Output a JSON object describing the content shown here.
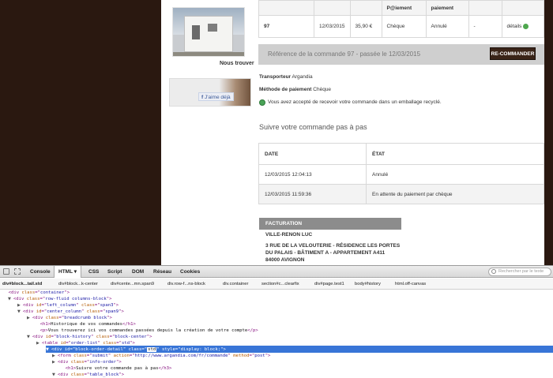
{
  "site": {
    "nous_trouver": "Nous trouver",
    "fb_like": "J'aime déjà",
    "orders": {
      "header": [
        "",
        "",
        "",
        "P@iement",
        "paiement",
        "",
        ""
      ],
      "row": [
        "97",
        "12/03/2015",
        "35,90 €",
        "Chèque",
        "Annulé",
        "-",
        "détails"
      ]
    },
    "reference_title": "Référence de la commande 97 - passée le 12/03/2015",
    "recommander": "RE-COMMANDER",
    "transporteur_label": "Transporteur",
    "transporteur_value": "Argandia",
    "paiement_label": "Méthode de paiement",
    "paiement_value": "Chèque",
    "recycle_text": "Vous avez accepté de recevoir votre commande dans un emballage recyclé.",
    "follow_title": "Suivre votre commande pas à pas",
    "history": {
      "headers": [
        "DATE",
        "ÉTAT"
      ],
      "rows": [
        [
          "12/03/2015 12:04:13",
          "Annulé"
        ],
        [
          "12/03/2015 11:59:36",
          "En attente du paiement par chèque"
        ]
      ]
    },
    "facturation_label": "FACTURATION",
    "address": [
      "VILLE-RENON LUC",
      "3 RUE DE LA VELOUTERIE - RÉSIDENCE LES PORTES",
      "DU PALAIS - BÂTIMENT A - APPARTEMENT A411",
      "84000 AVIGNON"
    ]
  },
  "devtools": {
    "tabs": [
      "Console",
      "HTML ▾",
      "CSS",
      "Script",
      "DOM",
      "Réseau",
      "Cookies"
    ],
    "search_placeholder": "Rechercher par le texte",
    "breadcrumbs": [
      "div#block...tail.std",
      "div#block...k-center",
      "div#cente...mn.span9",
      "div.row-f...ns-block",
      "div.container",
      "section#c...clearfix",
      "div#page.test1",
      "body#history",
      "html.off-canvas"
    ],
    "tree": [
      {
        "tw": "",
        "parts": [
          [
            "tag",
            "<div "
          ],
          [
            "an",
            "class"
          ],
          [
            "tag",
            "=\""
          ],
          [
            "av",
            "container"
          ],
          [
            "tag",
            "\">"
          ]
        ]
      },
      {
        "tw": "▼",
        "parts": [
          [
            "tag",
            "<div "
          ],
          [
            "an",
            "class"
          ],
          [
            "tag",
            "=\""
          ],
          [
            "av",
            "row-fluid columns-block"
          ],
          [
            "tag",
            "\">"
          ]
        ]
      },
      {
        "tw": "▶",
        "parts": [
          [
            "tag",
            "<div "
          ],
          [
            "an",
            "id"
          ],
          [
            "tag",
            "=\""
          ],
          [
            "av",
            "left_column"
          ],
          [
            "tag",
            "\" "
          ],
          [
            "an",
            "class"
          ],
          [
            "tag",
            "=\""
          ],
          [
            "av",
            "span3"
          ],
          [
            "tag",
            "\">"
          ]
        ]
      },
      {
        "tw": "▼",
        "parts": [
          [
            "tag",
            "<div "
          ],
          [
            "an",
            "id"
          ],
          [
            "tag",
            "=\""
          ],
          [
            "av",
            "center_column"
          ],
          [
            "tag",
            "\" "
          ],
          [
            "an",
            "class"
          ],
          [
            "tag",
            "=\""
          ],
          [
            "av",
            "span9"
          ],
          [
            "tag",
            "\">"
          ]
        ]
      },
      {
        "tw": "▶",
        "parts": [
          [
            "tag",
            "<div "
          ],
          [
            "an",
            "class"
          ],
          [
            "tag",
            "=\""
          ],
          [
            "av",
            "breadcrumb block"
          ],
          [
            "tag",
            "\">"
          ]
        ]
      },
      {
        "tw": "",
        "parts": [
          [
            "tag",
            "<h1>"
          ],
          [
            "tx",
            "Historique de vos commandes"
          ],
          [
            "tag",
            "</h1>"
          ]
        ]
      },
      {
        "tw": "",
        "parts": [
          [
            "tag",
            "<p>"
          ],
          [
            "tx",
            "Vous trouverez ici vos commandes passées depuis la création de votre compte"
          ],
          [
            "tag",
            "</p>"
          ]
        ]
      },
      {
        "tw": "▼",
        "parts": [
          [
            "tag",
            "<div "
          ],
          [
            "an",
            "id"
          ],
          [
            "tag",
            "=\""
          ],
          [
            "av",
            "block-history"
          ],
          [
            "tag",
            "\" "
          ],
          [
            "an",
            "class"
          ],
          [
            "tag",
            "=\""
          ],
          [
            "av",
            "block-center"
          ],
          [
            "tag",
            "\">"
          ]
        ]
      },
      {
        "tw": "▶",
        "parts": [
          [
            "tag",
            "<table "
          ],
          [
            "an",
            "id"
          ],
          [
            "tag",
            "=\""
          ],
          [
            "av",
            "order-list"
          ],
          [
            "tag",
            "\" "
          ],
          [
            "an",
            "class"
          ],
          [
            "tag",
            "=\""
          ],
          [
            "av",
            "std"
          ],
          [
            "tag",
            "\">"
          ]
        ]
      },
      {
        "tw": "▼",
        "parts": [
          [
            "tag",
            "<div "
          ],
          [
            "an",
            "id"
          ],
          [
            "tag",
            "=\""
          ],
          [
            "av",
            "block-order-detail"
          ],
          [
            "tag",
            "\" "
          ],
          [
            "an",
            "class"
          ],
          [
            "tag",
            "=\""
          ],
          [
            "av",
            "std"
          ],
          [
            "tag",
            "\" "
          ],
          [
            "an",
            "style"
          ],
          [
            "tag",
            "=\""
          ],
          [
            "av",
            "display: block;"
          ],
          [
            "tag",
            "\">"
          ]
        ]
      },
      {
        "tw": "▶",
        "parts": [
          [
            "tag",
            "<form "
          ],
          [
            "an",
            "class"
          ],
          [
            "tag",
            "=\""
          ],
          [
            "av",
            "submit"
          ],
          [
            "tag",
            "\" "
          ],
          [
            "an",
            "action"
          ],
          [
            "tag",
            "=\""
          ],
          [
            "av",
            "http://www.argandia.com/fr/commande"
          ],
          [
            "tag",
            "\" "
          ],
          [
            "an",
            "method"
          ],
          [
            "tag",
            "=\""
          ],
          [
            "av",
            "post"
          ],
          [
            "tag",
            "\">"
          ]
        ]
      },
      {
        "tw": "▶",
        "parts": [
          [
            "tag",
            "<div "
          ],
          [
            "an",
            "class"
          ],
          [
            "tag",
            "=\""
          ],
          [
            "av",
            "info-order"
          ],
          [
            "tag",
            "\">"
          ]
        ]
      },
      {
        "tw": "",
        "parts": [
          [
            "tag",
            "<h1>"
          ],
          [
            "tx",
            "Suivre votre commande pas à pas"
          ],
          [
            "tag",
            "</h3>"
          ]
        ]
      },
      {
        "tw": "▼",
        "parts": [
          [
            "tag",
            "<div "
          ],
          [
            "an",
            "class"
          ],
          [
            "tag",
            "=\""
          ],
          [
            "av",
            "table_block"
          ],
          [
            "tag",
            "\">"
          ]
        ]
      }
    ]
  }
}
